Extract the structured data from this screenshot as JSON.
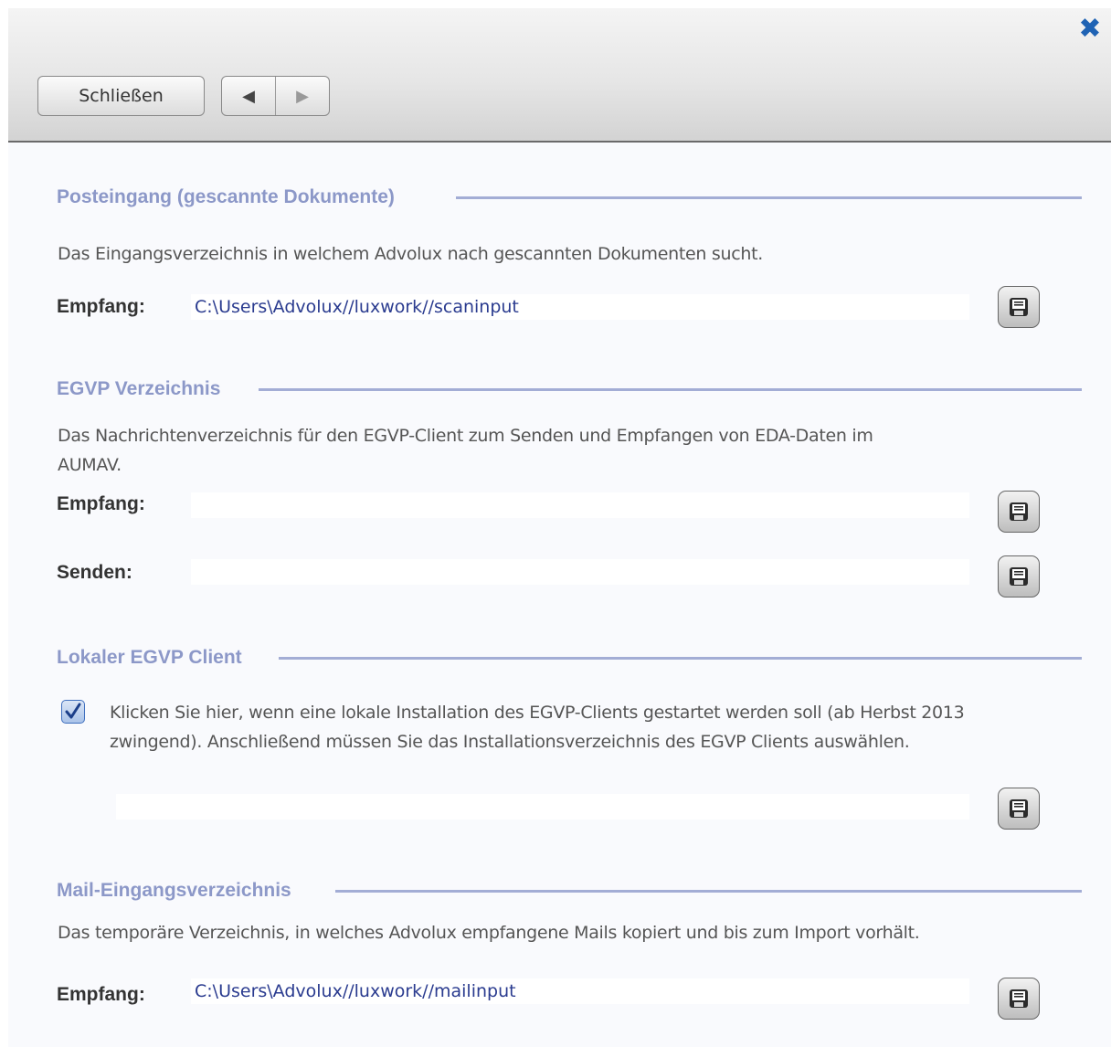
{
  "toolbar": {
    "close_label": "Schließen",
    "prev_glyph": "◀",
    "next_glyph": "▶",
    "close_icon_glyph": "✖"
  },
  "sections": {
    "inbox": {
      "title": "Posteingang (gescannte Dokumente)",
      "description": "Das Eingangsverzeichnis in welchem Advolux nach gescannten Dokumenten sucht.",
      "receive_label": "Empfang:",
      "receive_value": "C:\\Users\\Advolux//luxwork//scaninput"
    },
    "egvp": {
      "title": "EGVP Verzeichnis",
      "description": "Das Nachrichtenverzeichnis für den EGVP-Client zum Senden und Empfangen von EDA-Daten im AUMAV.",
      "receive_label": "Empfang:",
      "receive_value": "",
      "send_label": "Senden:",
      "send_value": ""
    },
    "local_client": {
      "title": "Lokaler EGVP Client",
      "checkbox_checked": true,
      "checkbox_text": "Klicken Sie hier, wenn eine lokale Installation des EGVP-Clients gestartet werden soll (ab Herbst 2013 zwingend). Anschließend müssen Sie das Installationsverzeichnis des EGVP Clients auswählen.",
      "path_value": ""
    },
    "mail": {
      "title": "Mail-Eingangsverzeichnis",
      "description": "Das temporäre Verzeichnis, in welches Advolux empfangene Mails kopiert und bis zum Import vorhält.",
      "receive_label": "Empfang:",
      "receive_value": "C:\\Users\\Advolux//luxwork//mailinput"
    }
  },
  "icons": {
    "save": "floppy-disk-icon",
    "check": "checkmark-icon",
    "accent_color": "#8c98c8",
    "link_color": "#2a3b8f"
  }
}
